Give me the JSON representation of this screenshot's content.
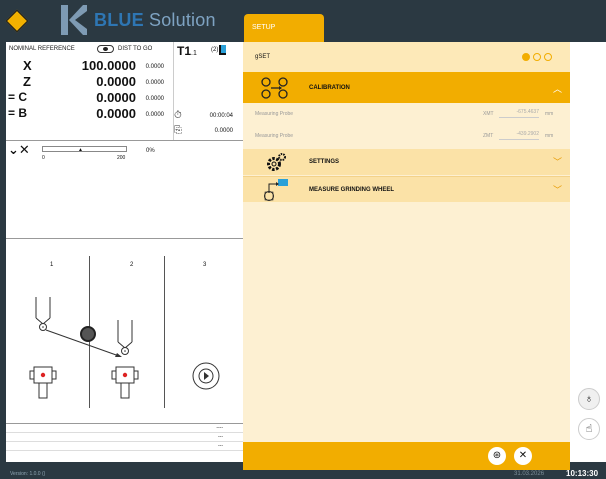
{
  "app": {
    "brand_bold": "BLUE",
    "brand_rest": " Solution",
    "tab": "SETUP"
  },
  "axes": {
    "header_left": "NOMINAL REFERENCE",
    "header_right": "DIST TO GO",
    "rows": [
      {
        "name": "X",
        "value": "100.0000",
        "dtg": "0.0000"
      },
      {
        "name": "Z",
        "value": "0.0000",
        "dtg": "0.0000"
      },
      {
        "name": "= C",
        "value": "0.0000",
        "dtg": "0.0000"
      },
      {
        "name": "= B",
        "value": "0.0000",
        "dtg": "0.0000"
      }
    ]
  },
  "tool": {
    "name": "T1",
    "sub": ".1",
    "count": "(2)",
    "time": "00:00:04",
    "counter": "0.0000"
  },
  "override": {
    "min": "0",
    "max": "200",
    "percent": "0%",
    "level": 0
  },
  "positions": [
    "1",
    "2",
    "3"
  ],
  "stats": [
    "----",
    "---",
    "---"
  ],
  "right": {
    "gset": "gSET",
    "calibration": "CALIBRATION",
    "probe_label": "Measuring Probe",
    "probe_rows": [
      {
        "axis": "XMT",
        "value": "-675.4637",
        "unit": "mm"
      },
      {
        "axis": "ZMT",
        "value": "-439.2902",
        "unit": "mm"
      }
    ],
    "settings": "SETTINGS",
    "measure": "MEASURE GRINDING WHEEL"
  },
  "footer": {
    "version": "Version: 1.0.0 ()",
    "date": "31.03.2026",
    "time": "10:13:30"
  },
  "colors": {
    "accent": "#f2ad00",
    "brand": "#2e76b3",
    "bar": "#2b3942"
  }
}
